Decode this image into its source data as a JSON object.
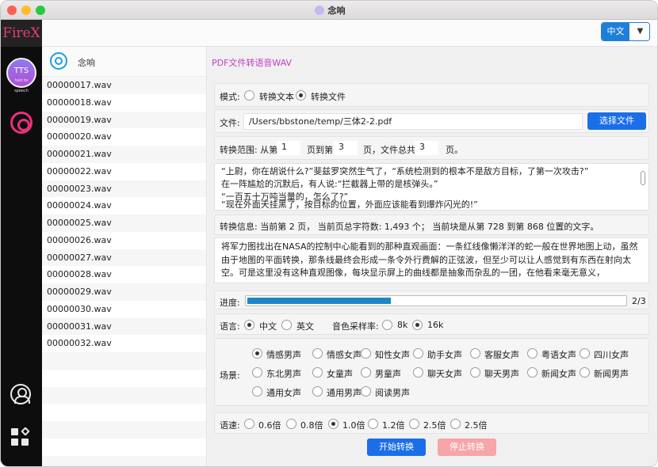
{
  "window": {
    "title": "念响"
  },
  "topbar": {
    "language": "中文",
    "dropdown_icon": "▼"
  },
  "sidebar": {
    "logo": "FireX",
    "tts_label": "TTS",
    "tts_sub": "text to speech"
  },
  "file_list": {
    "header": "念响",
    "items": [
      "00000017.wav",
      "00000018.wav",
      "00000019.wav",
      "00000020.wav",
      "00000021.wav",
      "00000022.wav",
      "00000023.wav",
      "00000024.wav",
      "00000025.wav",
      "00000026.wav",
      "00000027.wav",
      "00000028.wav",
      "00000029.wav",
      "00000030.wav",
      "00000031.wav",
      "00000032.wav"
    ]
  },
  "main": {
    "breadcrumb": "PDF文件转语音WAV",
    "mode": {
      "label": "模式:",
      "options": [
        "转换文本",
        "转换文件"
      ],
      "selected": "转换文件"
    },
    "file": {
      "label": "文件:",
      "path": "/Users/bbstone/temp/三体2-2.pdf",
      "button": "选择文件"
    },
    "range": {
      "label": "转换范围: 从第",
      "from": "1",
      "to_label": "页到第",
      "to": "3",
      "total_label": "页，文件总共",
      "total": "3",
      "end_label": "页。"
    },
    "preview_lines": [
      "“上尉，你在胡说什么?”斐兹罗突然生气了，“系统检测到的根本不是敌方目标，了第一次攻击?”",
      "在一阵尴尬的沉默后，有人说:“拦截器上带的是核弹头。”",
      "“一百五十万吨当量的，怎么了?”",
      "“现在外面天挂黑了，按目标的位置，外面应该能看到爆炸闪光的!”"
    ],
    "info": "转换信息: 当前第 2 页， 当前页总字符数: 1,493 个； 当前块是从第 728 到第 868 位置的文字。",
    "current_block": "将军力图找出在NASA的控制中心能看到的那种直观画面：一条红线像懒洋洋的蛇一般在世界地图上动，虽然由于地图的平面转换，那条线最终会形成一条令外行费解的正弦波，但至少可以让人感觉到有东西在射向太空。可是这里没有这种直观图像，每块显示屏上的曲线都是抽象而杂乱的一团，在他看来毫无意义，",
    "progress": {
      "label": "进度:",
      "value": 0.38,
      "text": "2/3"
    },
    "language": {
      "label": "语言:",
      "options": [
        "中文",
        "英文"
      ],
      "selected": "中文"
    },
    "sample_rate": {
      "label": "音色采样率:",
      "options": [
        "8k",
        "16k"
      ],
      "selected": "16k"
    },
    "scene": {
      "label": "场景:",
      "options": [
        "情感男声",
        "情感女声",
        "知性女声",
        "助手女声",
        "客服女声",
        "粤语女声",
        "四川女声",
        "东北男声",
        "女童声",
        "男童声",
        "聊天女声",
        "聊天男声",
        "新闻女声",
        "新闻男声",
        "通用女声",
        "通用男声",
        "阅读男声"
      ],
      "selected": "情感男声"
    },
    "speed": {
      "label": "语速:",
      "options": [
        "0.6倍",
        "0.8倍",
        "1.0倍",
        "1.2倍",
        "2.5倍",
        "2.5倍"
      ],
      "selected_index": 2
    },
    "start_button": "开始转换",
    "stop_button": "停止转换"
  }
}
